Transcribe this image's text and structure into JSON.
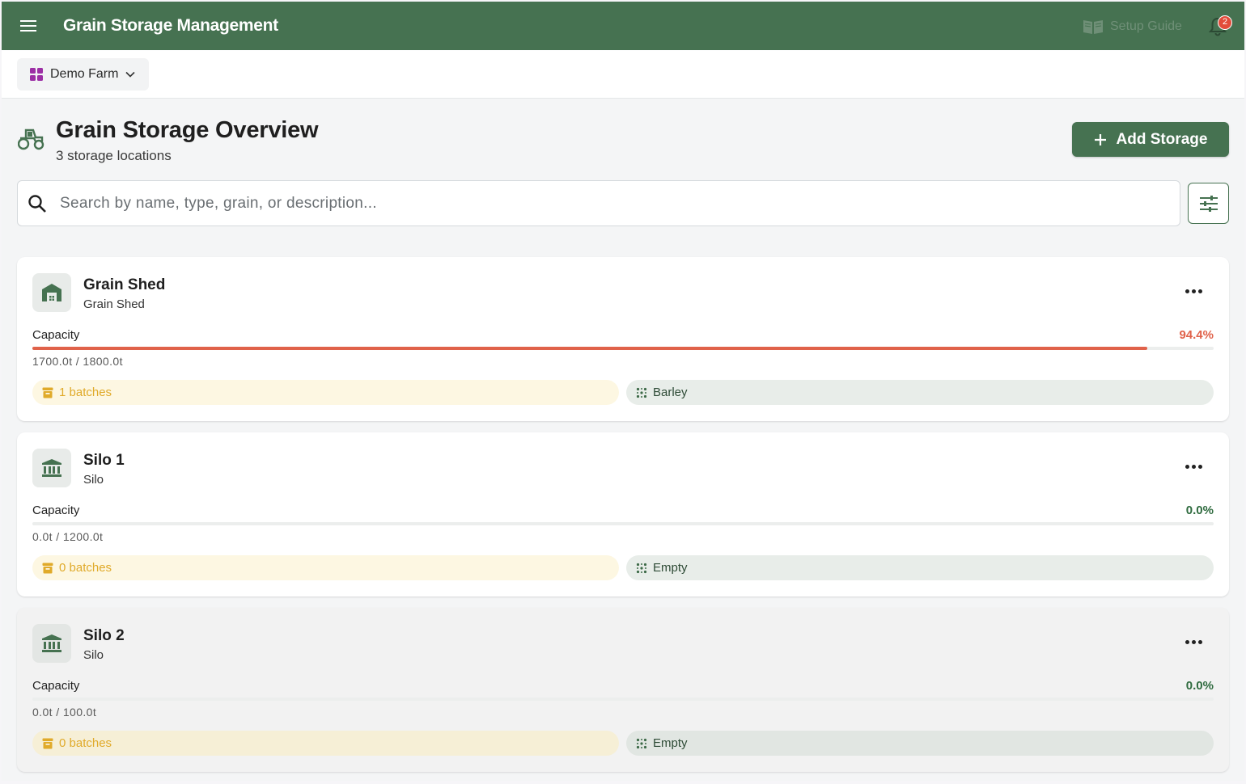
{
  "app": {
    "title": "Grain Storage Management",
    "setup_guide": "Setup Guide",
    "notification_count": "2",
    "colors": {
      "primary": "#467251",
      "danger": "#e0624a",
      "ok": "#2f6b3f"
    }
  },
  "farm_selector": {
    "label": "Demo Farm",
    "icon": "grid-icon"
  },
  "header": {
    "title": "Grain Storage Overview",
    "subtitle": "3 storage locations",
    "add_button": "Add Storage"
  },
  "search": {
    "placeholder": "Search by name, type, grain, or description..."
  },
  "storages": [
    {
      "name": "Grain Shed",
      "type": "Grain Shed",
      "icon": "warehouse-icon",
      "capacity_label": "Capacity",
      "percent": "94.4%",
      "fill": 0.944,
      "level": "high",
      "amounts": "1700.0t / 1800.0t",
      "batches": "1 batches",
      "grain": "Barley"
    },
    {
      "name": "Silo 1",
      "type": "Silo",
      "icon": "silo-icon",
      "capacity_label": "Capacity",
      "percent": "0.0%",
      "fill": 0.0,
      "level": "ok",
      "amounts": "0.0t / 1200.0t",
      "batches": "0 batches",
      "grain": "Empty"
    },
    {
      "name": "Silo 2",
      "type": "Silo",
      "icon": "silo-icon",
      "capacity_label": "Capacity",
      "percent": "0.0%",
      "fill": 0.0,
      "level": "ok",
      "amounts": "0.0t / 100.0t",
      "batches": "0 batches",
      "grain": "Empty"
    }
  ]
}
